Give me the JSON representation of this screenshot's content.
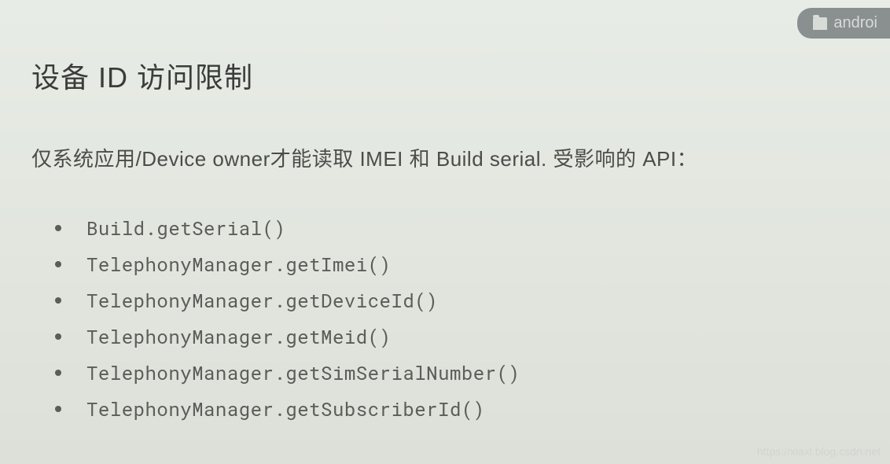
{
  "badge": {
    "label": "androi"
  },
  "slide": {
    "title": "设备 ID 访问限制",
    "subtitle": "仅系统应用/Device owner才能读取 IMEI 和 Build serial.  受影响的 API：",
    "apis": [
      "Build.getSerial()",
      "TelephonyManager.getImei()",
      "TelephonyManager.getDeviceId()",
      "TelephonyManager.getMeid()",
      "TelephonyManager.getSimSerialNumber()",
      "TelephonyManager.getSubscriberId()"
    ]
  },
  "watermark": "https://xiaxl.blog.csdn.net"
}
